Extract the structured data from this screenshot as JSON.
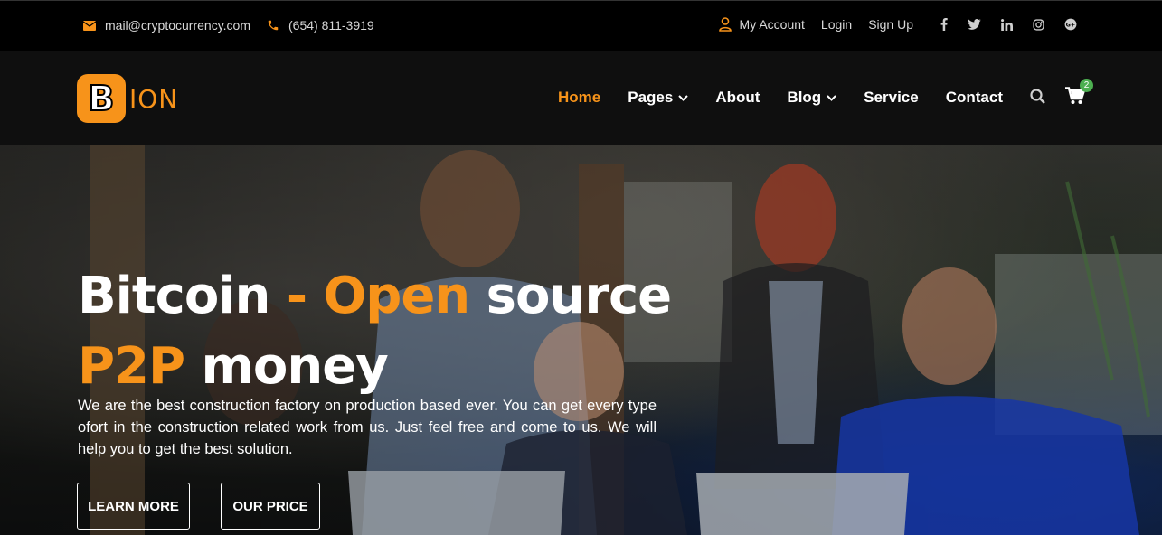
{
  "topbar": {
    "email": "mail@cryptocurrency.com",
    "phone": "(654) 811-3919",
    "my_account": "My Account",
    "login": "Login",
    "signup": "Sign Up",
    "social_icons": [
      "facebook-icon",
      "twitter-icon",
      "linkedin-icon",
      "instagram-icon",
      "google-plus-icon"
    ]
  },
  "logo": {
    "letter": "B",
    "text": "ION"
  },
  "nav": {
    "items": [
      {
        "label": "Home",
        "active": true,
        "dropdown": false
      },
      {
        "label": "Pages",
        "active": false,
        "dropdown": true
      },
      {
        "label": "About",
        "active": false,
        "dropdown": false
      },
      {
        "label": "Blog",
        "active": false,
        "dropdown": true
      },
      {
        "label": "Service",
        "active": false,
        "dropdown": false
      },
      {
        "label": "Contact",
        "active": false,
        "dropdown": false
      }
    ],
    "cart_count": "2"
  },
  "hero": {
    "title_part1": "Bitcoin",
    "title_dash": " - ",
    "title_part2": "Open",
    "title_part3": " source",
    "title_line2_orange": "P2P",
    "title_line2_white": " money",
    "description": "We are the best construction factory on production based ever. You can get every type ofort in the construction related work from us. Just feel free and come to us. We will help you to get the best solution.",
    "btn_learn": "LEARN MORE",
    "btn_price": "OUR PRICE"
  },
  "colors": {
    "accent": "#f7931a",
    "topbar_bg": "#000000",
    "navbar_bg": "#0f0f0f",
    "badge": "#4caf50"
  }
}
